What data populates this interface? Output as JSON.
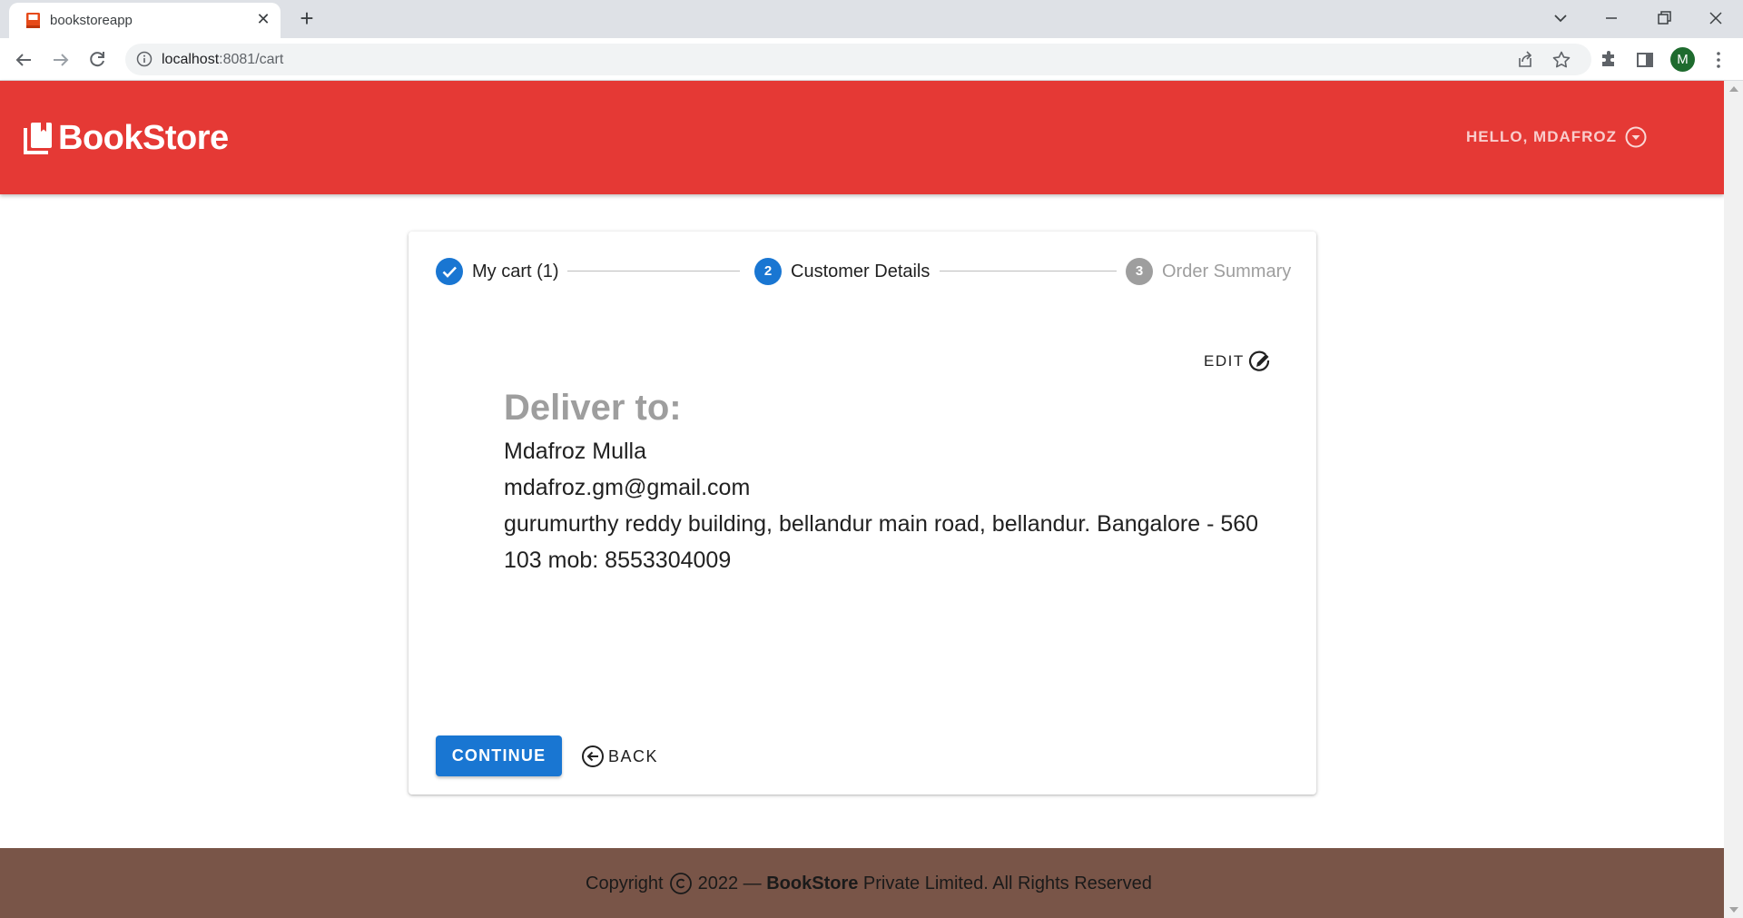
{
  "browser": {
    "tab_title": "bookstoreapp",
    "url_host": "localhost",
    "url_path": ":8081/cart",
    "profile_initial": "M"
  },
  "header": {
    "brand": "BookStore",
    "user_greeting": "HELLO, MDAFROZ",
    "color": "#e53935"
  },
  "stepper": {
    "steps": [
      {
        "label": "My cart (1)",
        "state": "completed",
        "number": "1"
      },
      {
        "label": "Customer Details",
        "state": "active",
        "number": "2"
      },
      {
        "label": "Order Summary",
        "state": "inactive",
        "number": "3"
      }
    ],
    "active_color": "#1976d2",
    "inactive_color": "#9e9e9e"
  },
  "customer": {
    "edit_label": "EDIT",
    "title": "Deliver to:",
    "name": "Mdafroz Mulla",
    "email": "mdafroz.gm@gmail.com",
    "address_line1": "gurumurthy reddy building, bellandur main road, bellandur. Bangalore - 560",
    "address_line2": "103 mob: 8553304009"
  },
  "actions": {
    "continue_label": "CONTINUE",
    "back_label": "BACK"
  },
  "footer": {
    "prefix": "Copyright",
    "year_dash": "2022 —",
    "brand": "BookStore",
    "suffix": "Private Limited. All Rights Reserved",
    "color": "#795548"
  }
}
